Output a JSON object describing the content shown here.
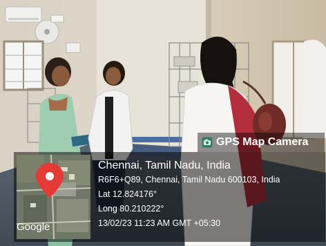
{
  "photo": {
    "subject": "Four women standing near metal wire shelving racks in a room with windows, a wall-mounted air conditioner and a fan"
  },
  "gps_stamp": {
    "app_name": "GPS Map Camera",
    "map_attribution": "Google",
    "location_title": "Chennai, Tamil Nadu, India",
    "address": "R6F6+Q89, Chennai, Tamil Nadu 600103, India",
    "latitude": "Lat 12.824176°",
    "longitude": "Long 80.210222°",
    "timestamp": "13/02/23 11:23 AM GMT +05:30",
    "pin_color": "#e53935"
  }
}
